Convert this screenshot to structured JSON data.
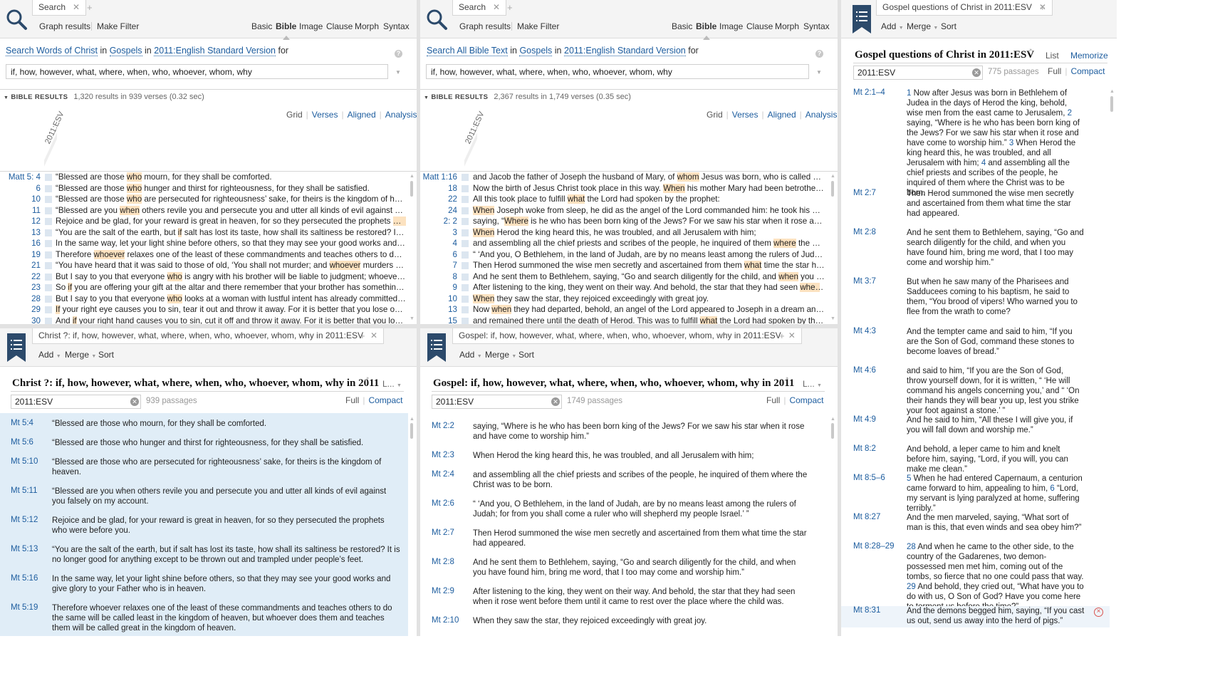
{
  "search1": {
    "tab_label": "Search",
    "toolbar": {
      "graph_results": "Graph results",
      "make_filter": "Make Filter"
    },
    "types": [
      "Basic",
      "Bible",
      "Image",
      "Clause",
      "Morph",
      "Syntax"
    ],
    "crumb": {
      "scope": "Search Words of Christ",
      "in1": "in",
      "range": "Gospels",
      "in2": "in",
      "version": "2011:English Standard Version",
      "for": "for"
    },
    "query": "if, how, however, what, where, when, who, whoever, whom, why",
    "results_label": "BIBLE RESULTS",
    "results_summary": "1,320 results in 939 verses (0.32 sec)",
    "views": {
      "grid": "Grid",
      "verses": "Verses",
      "aligned": "Aligned",
      "analysis": "Analysis"
    },
    "column": "2011:ESV",
    "rows": [
      {
        "ref": "Matt  5:  4",
        "pre": "“Blessed are those ",
        "hl": "who",
        "post": " mourn, for they shall be comforted."
      },
      {
        "ref": "6",
        "pre": "“Blessed are those ",
        "hl": "who",
        "post": " hunger and thirst for righteousness, for they shall be satisfied."
      },
      {
        "ref": "10",
        "pre": "“Blessed are those ",
        "hl": "who",
        "post": " are persecuted for righteousness’ sake, for theirs is the kingdom of heaven."
      },
      {
        "ref": "11",
        "pre": "“Blessed are you ",
        "hl": "when",
        "post": " others revile you and persecute you and utter all kinds of evil against you f..."
      },
      {
        "ref": "12",
        "pre": "Rejoice and be glad, for your reward is great in heaven, for so they persecuted the prophets ",
        "hl": "who",
        "post": "..."
      },
      {
        "ref": "13",
        "pre": "“You are the salt of the earth, but ",
        "hl": "if",
        "post": " salt has lost its taste, how shall its saltiness be restored? It is n..."
      },
      {
        "ref": "16",
        "pre": "In the same way, let your light shine before others, so that they may see your good works and give...",
        "hl": "",
        "post": ""
      },
      {
        "ref": "19",
        "pre": "Therefore ",
        "hl": "whoever",
        "post": " relaxes one of the least of these commandments and teaches others to do the..."
      },
      {
        "ref": "21",
        "pre": "“You have heard that it was said to those of old, ‘You shall not murder; and ",
        "hl": "whoever",
        "post": " murders will..."
      },
      {
        "ref": "22",
        "pre": "But I say to you that everyone ",
        "hl": "who",
        "post": " is angry with his brother will be liable to judgment; whoever in..."
      },
      {
        "ref": "23",
        "pre": "So ",
        "hl": "if",
        "post": " you are offering your gift at the altar and there remember that your brother has something a..."
      },
      {
        "ref": "28",
        "pre": "But I say to you that everyone ",
        "hl": "who",
        "post": " looks at a woman with lustful intent has already committed a..."
      },
      {
        "ref": "29",
        "pre": "",
        "hl": "If",
        "post": " your right eye causes you to sin, tear it out and throw it away. For it is better that you lose one o..."
      },
      {
        "ref": "30",
        "pre": "And ",
        "hl": "if",
        "post": " your right hand causes you to sin, cut it off and throw it away. For it is better that you lose one..."
      }
    ]
  },
  "search2": {
    "tab_label": "Search",
    "toolbar": {
      "graph_results": "Graph results",
      "make_filter": "Make Filter"
    },
    "types": [
      "Basic",
      "Bible",
      "Image",
      "Clause",
      "Morph",
      "Syntax"
    ],
    "crumb": {
      "scope": "Search All Bible Text",
      "in1": "in",
      "range": "Gospels",
      "in2": "in",
      "version": "2011:English Standard Version",
      "for": "for"
    },
    "query": "if, how, however, what, where, when, who, whoever, whom, why",
    "results_label": "BIBLE RESULTS",
    "results_summary": "2,367 results in 1,749 verses (0.35 sec)",
    "views": {
      "grid": "Grid",
      "verses": "Verses",
      "aligned": "Aligned",
      "analysis": "Analysis"
    },
    "column": "2011:ESV",
    "rows": [
      {
        "ref": "Matt 1:16",
        "pre": "and Jacob the father of Joseph the husband of Mary, of ",
        "hl": "whom",
        "post": " Jesus was born, who is called Christ."
      },
      {
        "ref": "18",
        "pre": "Now the birth of Jesus Christ took place in this way. ",
        "hl": "When",
        "post": " his mother Mary had been betrothed to..."
      },
      {
        "ref": "22",
        "pre": "All this took place to fulfill ",
        "hl": "what",
        "post": " the Lord had spoken by the prophet:"
      },
      {
        "ref": "24",
        "pre": "",
        "hl": "When",
        "post": " Joseph woke from sleep, he did as the angel of the Lord commanded him: he took his wife,"
      },
      {
        "ref": "2:  2",
        "pre": "saying, “",
        "hl": "Where",
        "post": " is he who has been born king of the Jews? For we saw his star when it rose and hav..."
      },
      {
        "ref": "3",
        "pre": "",
        "hl": "When",
        "post": " Herod the king heard this, he was troubled, and all Jerusalem with him;"
      },
      {
        "ref": "4",
        "pre": "and assembling all the chief priests and scribes of the people, he inquired of them ",
        "hl": "where",
        "post": " the Christ..."
      },
      {
        "ref": "6",
        "pre": "“ ‘And you, O Bethlehem, in the land of Judah, are by no means least among the rulers of Judah; fo...",
        "hl": "",
        "post": ""
      },
      {
        "ref": "7",
        "pre": "Then Herod summoned the wise men secretly and ascertained from them ",
        "hl": "what",
        "post": " time the star had a..."
      },
      {
        "ref": "8",
        "pre": "And he sent them to Bethlehem, saying, “Go and search diligently for the child, and ",
        "hl": "when",
        "post": " you have..."
      },
      {
        "ref": "9",
        "pre": "After listening to the king, they went on their way. And behold, the star that they had seen ",
        "hl": "when",
        "post": " it r..."
      },
      {
        "ref": "10",
        "pre": "",
        "hl": "When",
        "post": " they saw the star, they rejoiced exceedingly with great joy."
      },
      {
        "ref": "13",
        "pre": "Now ",
        "hl": "when",
        "post": " they had departed, behold, an angel of the Lord appeared to Joseph in a dream and sai..."
      },
      {
        "ref": "15",
        "pre": "and remained there until the death of Herod. This was to fulfill ",
        "hl": "what",
        "post": " the Lord had spoken by the pr..."
      }
    ]
  },
  "list1": {
    "tab_label": "Christ ?: if, how, however, what, where, when, who, whoever, whom, why in 2011:ESV",
    "toolbar": {
      "add": "Add",
      "merge": "Merge",
      "sort": "Sort"
    },
    "title": "Christ ?: if, how, however, what, where, when, who, whoever, whom, why in 2011",
    "title_menu": "L...",
    "filter": "2011:ESV",
    "passages": "939 passages",
    "full": "Full",
    "compact": "Compact",
    "items": [
      {
        "ref": "Mt 5:4",
        "text": "“Blessed are those who mourn, for they shall be comforted."
      },
      {
        "ref": "Mt 5:6",
        "text": "“Blessed are those who hunger and thirst for righteousness, for they shall be satisfied."
      },
      {
        "ref": "Mt 5:10",
        "text": "“Blessed are those who are persecuted for righteousness’ sake, for theirs is the kingdom of heaven."
      },
      {
        "ref": "Mt 5:11",
        "text": "“Blessed are you when others revile you and persecute you and utter all kinds of evil against you falsely on my account."
      },
      {
        "ref": "Mt 5:12",
        "text": "Rejoice and be glad, for your reward is great in heaven, for so they persecuted the prophets who were before you."
      },
      {
        "ref": "Mt 5:13",
        "text": "“You are the salt of the earth, but if salt has lost its taste, how shall its saltiness be restored? It is no longer good for anything except to be thrown out and trampled under people’s feet."
      },
      {
        "ref": "Mt 5:16",
        "text": "In the same way, let your light shine before others, so that they may see your good works and give glory to your Father who is in heaven."
      },
      {
        "ref": "Mt 5:19",
        "text": "Therefore whoever relaxes one of the least of these commandments and teaches others to do the same will be called least in the kingdom of heaven, but whoever does them and teaches them will be called great in the kingdom of heaven."
      }
    ]
  },
  "list2": {
    "tab_label": "Gospel: if, how, however, what, where, when, who, whoever, whom, why in 2011:ESV",
    "toolbar": {
      "add": "Add",
      "merge": "Merge",
      "sort": "Sort"
    },
    "title": "Gospel: if, how, however, what, where, when, who, whoever, whom, why in 2011",
    "title_menu": "L...",
    "filter": "2011:ESV",
    "passages": "1749 passages",
    "full": "Full",
    "compact": "Compact",
    "items": [
      {
        "ref": "Mt 2:2",
        "text": "saying, “Where is he who has been born king of the Jews? For we saw his star when it rose and have come to worship him.”"
      },
      {
        "ref": "Mt 2:3",
        "text": "When Herod the king heard this, he was troubled, and all Jerusalem with him;"
      },
      {
        "ref": "Mt 2:4",
        "text": "and assembling all the chief priests and scribes of the people, he inquired of them where the Christ was to be born."
      },
      {
        "ref": "Mt 2:6",
        "text": "“ ‘And you, O Bethlehem, in the land of Judah, are by no means least among the rulers of Judah; for from you shall come a ruler who will shepherd my people Israel.’ ”"
      },
      {
        "ref": "Mt 2:7",
        "text": "Then Herod summoned the wise men secretly and ascertained from them what time the star had appeared."
      },
      {
        "ref": "Mt 2:8",
        "text": "And he sent them to Bethlehem, saying, “Go and search diligently for the child, and when you have found him, bring me word, that I too may come and worship him.”"
      },
      {
        "ref": "Mt 2:9",
        "text": "After listening to the king, they went on their way. And behold, the star that they had seen when it rose went before them until it came to rest over the place where the child was."
      },
      {
        "ref": "Mt 2:10",
        "text": "When they saw the star, they rejoiced exceedingly with great joy."
      }
    ]
  },
  "list3": {
    "tab_label": "Gospel questions of Christ in 2011:ESV",
    "toolbar": {
      "add": "Add",
      "merge": "Merge",
      "sort": "Sort"
    },
    "title": "Gospel questions of Christ in 2011:ESV",
    "list_link": "List",
    "memorize_link": "Memorize",
    "filter": "2011:ESV",
    "passages": "775 passages",
    "full": "Full",
    "compact": "Compact",
    "items": [
      {
        "ref": "Mt 2:1–4",
        "text": "1 Now after Jesus was born in Bethlehem of Judea in the days of Herod the king, behold, wise men from the east came to Jerusalem, 2 saying, “Where is he who has been born king of the Jews? For we saw his star when it rose and have come to worship him.” 3 When Herod the king heard this, he was troubled, and all Jerusalem with him; 4 and assembling all the chief priests and scribes of the people, he inquired of them where the Christ was to be born."
      },
      {
        "ref": "Mt 2:7",
        "text": "Then Herod summoned the wise men secretly and ascertained from them what time the star had appeared."
      },
      {
        "ref": "Mt 2:8",
        "text": "And he sent them to Bethlehem, saying, “Go and search diligently for the child, and when you have found him, bring me word, that I too may come and worship him.”"
      },
      {
        "ref": "Mt 3:7",
        "text": "But when he saw many of the Pharisees and Sadducees coming to his baptism, he said to them, “You brood of vipers! Who warned you to flee from the wrath to come?"
      },
      {
        "ref": "Mt 4:3",
        "text": "And the tempter came and said to him, “If you are the Son of God, command these stones to become loaves of bread.”"
      },
      {
        "ref": "Mt 4:6",
        "text": "and said to him, “If you are the Son of God, throw yourself down, for it is written, “ ‘He will command his angels concerning you,’ and “ ‘On their hands they will bear you up, lest you strike your foot against a stone.’ ”"
      },
      {
        "ref": "Mt 4:9",
        "text": "And he said to him, “All these I will give you, if you will fall down and worship me.”"
      },
      {
        "ref": "Mt 8:2",
        "text": "And behold, a leper came to him and knelt before him, saying, “Lord, if you will, you can make me clean.”"
      },
      {
        "ref": "Mt 8:5–6",
        "text": "5 When he had entered Capernaum, a centurion came forward to him, appealing to him, 6 “Lord, my servant is lying paralyzed at home, suffering terribly.”"
      },
      {
        "ref": "Mt 8:27",
        "text": "And the men marveled, saying, “What sort of man is this, that even winds and sea obey him?”"
      },
      {
        "ref": "Mt 8:28–29",
        "text": "28 And when he came to the other side, to the country of the Gadarenes, two demon-possessed men met him, coming out of the tombs, so fierce that no one could pass that way. 29 And behold, they cried out, “What have you to do with us, O Son of God? Have you come here to torment us before the time?”"
      },
      {
        "ref": "Mt 8:31",
        "text": "And the demons begged him, saying, “If you cast us out, send us away into the herd of pigs.”"
      }
    ]
  }
}
